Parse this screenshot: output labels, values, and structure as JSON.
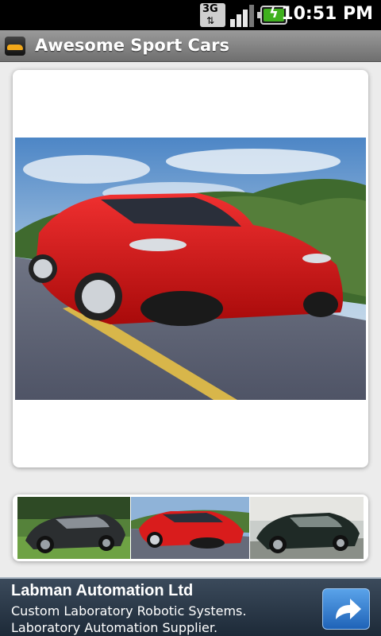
{
  "status_bar": {
    "network": "3G",
    "time": "10:51 PM"
  },
  "app": {
    "title": "Awesome Sport Cars"
  },
  "gallery": {
    "main_image": "red-sports-car-photo",
    "thumbnails": [
      "black-sports-car-photo",
      "red-sports-car-photo",
      "dark-green-sports-car-photo"
    ]
  },
  "ad": {
    "headline": "Labman Automation Ltd",
    "body": "Custom Laboratory Robotic Systems. Laboratory Automation Supplier."
  }
}
